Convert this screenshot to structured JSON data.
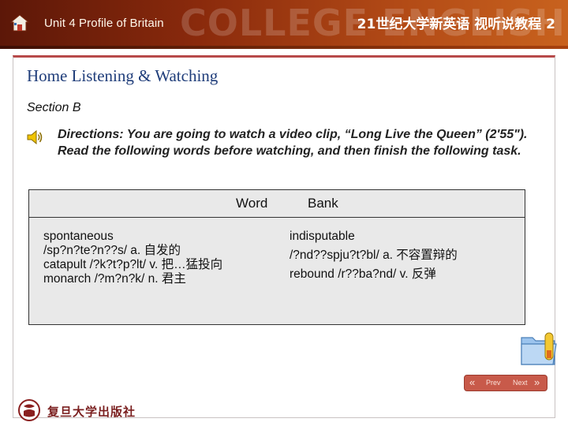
{
  "header": {
    "unit_title": "Unit 4  Profile of Britain",
    "watermark": "COLLEGE ENGLISH",
    "series": "21世纪大学新英语 视听说教程 2"
  },
  "main": {
    "heading": "Home Listening & Watching",
    "section": "Section B",
    "directions": "Directions: You are going to watch a video clip, “Long Live the Queen” (2'55\"). Read the following words before watching, and then finish the following task."
  },
  "word_bank": {
    "header_word": "Word",
    "header_bank": "Bank",
    "left_entries": [
      "spontaneous",
      "/sp?n?te?n??s/ a. 自发的",
      "catapult /?k?t?p?lt/ v. 把…猛投向",
      "monarch /?m?n?k/ n. 君主"
    ],
    "right_entries": [
      "indisputable",
      "/?nd??spju?t?bl/ a. 不容置辩的",
      "rebound /r??ba?nd/ v. 反弹"
    ]
  },
  "nav": {
    "prev_label": "Prev",
    "next_label": "Next"
  },
  "footer": {
    "publisher": "复旦大学出版社"
  },
  "colors": {
    "banner_dark": "#5c1708",
    "banner_light": "#c8621e",
    "heading": "#1f3d7a",
    "frame_accent": "#b74a4a",
    "wordbank_bg": "#e9e9e9",
    "nav_bg": "#c85a4a"
  },
  "icons": {
    "home": "home-icon",
    "speaker": "speaker-icon",
    "folder": "folder-icon",
    "prev": "prev-arrow-icon",
    "next": "next-arrow-icon",
    "publisher_logo": "publisher-logo-icon"
  }
}
